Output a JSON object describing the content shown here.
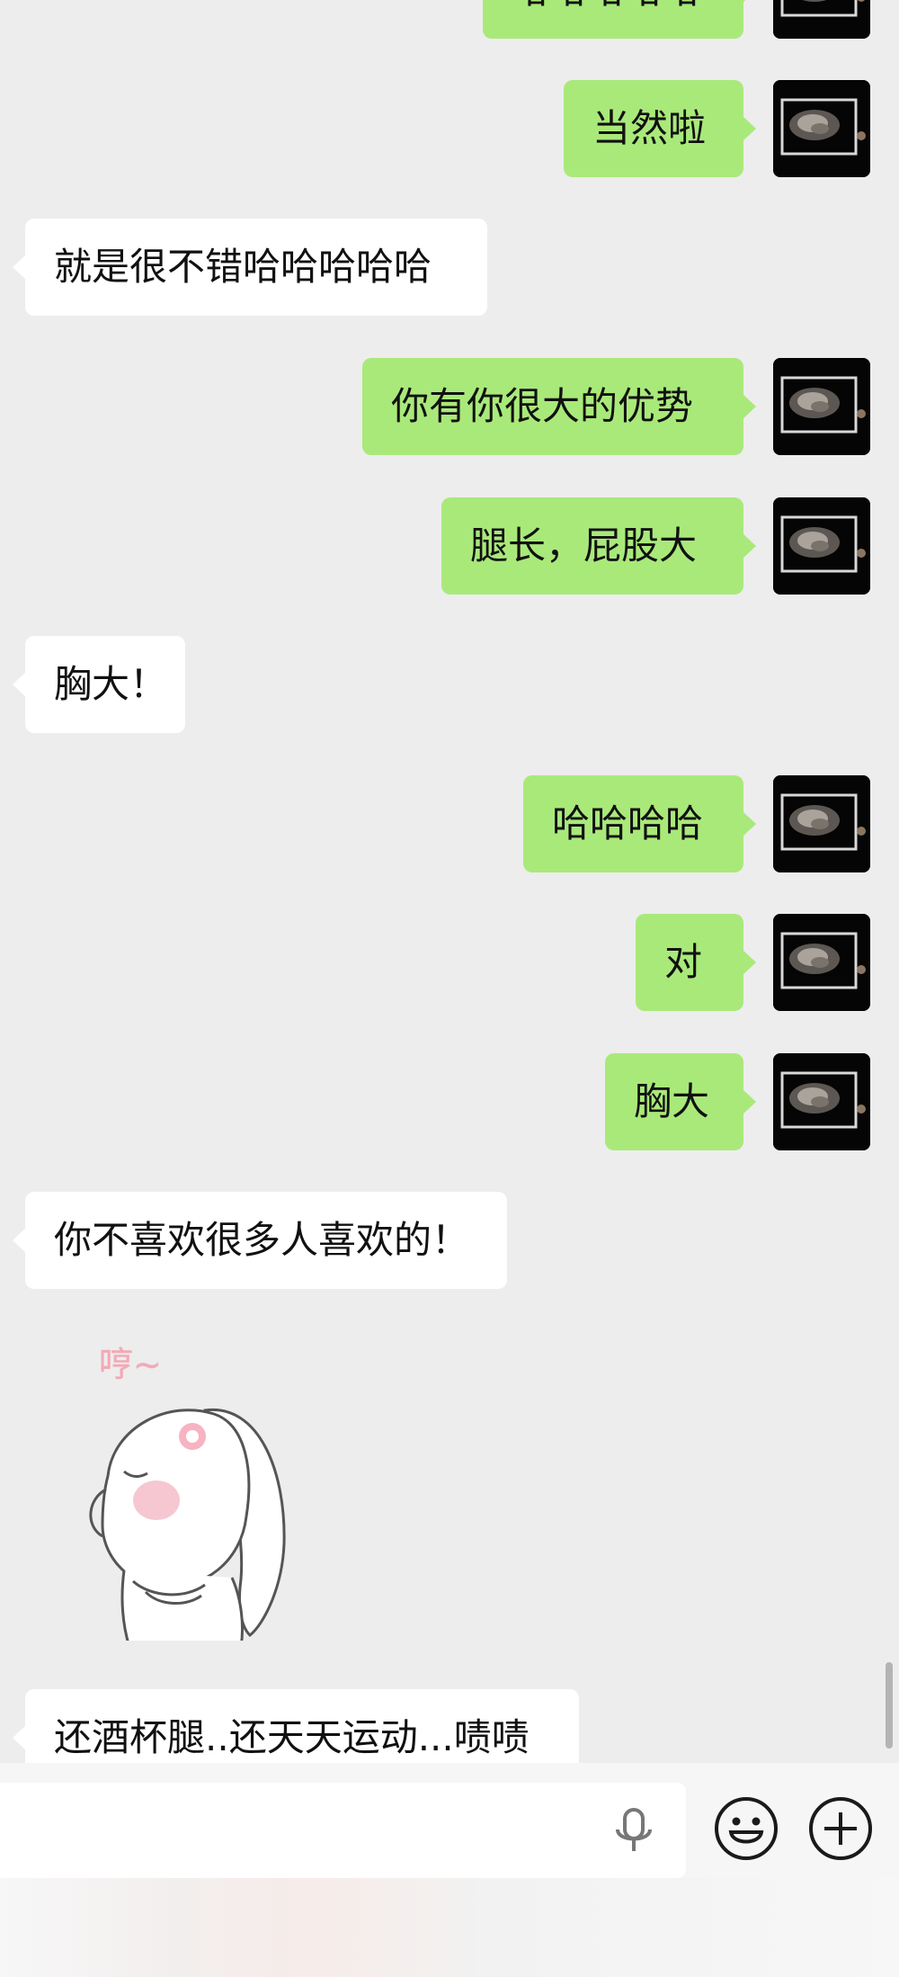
{
  "chat": {
    "messages": [
      {
        "side": "sent",
        "text": "哈哈哈哈哈"
      },
      {
        "side": "sent",
        "text": "当然啦"
      },
      {
        "side": "received",
        "text": "就是很不错哈哈哈哈哈"
      },
      {
        "side": "sent",
        "text": "你有你很大的优势"
      },
      {
        "side": "sent",
        "text": "腿长，屁股大"
      },
      {
        "side": "received",
        "text": "胸大！"
      },
      {
        "side": "sent",
        "text": "哈哈哈哈"
      },
      {
        "side": "sent",
        "text": "对"
      },
      {
        "side": "sent",
        "text": "胸大"
      },
      {
        "side": "received",
        "text": "你不喜欢很多人喜欢的！"
      },
      {
        "side": "received",
        "type": "sticker",
        "sticker_text": "哼~"
      },
      {
        "side": "received",
        "text": "还酒杯腿..还天天运动...啧啧"
      }
    ]
  },
  "input_bar": {
    "value": "",
    "icons": {
      "voice": "mic-icon",
      "emoji": "emoji-icon",
      "more": "plus-icon"
    }
  },
  "colors": {
    "background": "#ededed",
    "sent_bubble": "#a9e97a",
    "received_bubble": "#ffffff"
  }
}
